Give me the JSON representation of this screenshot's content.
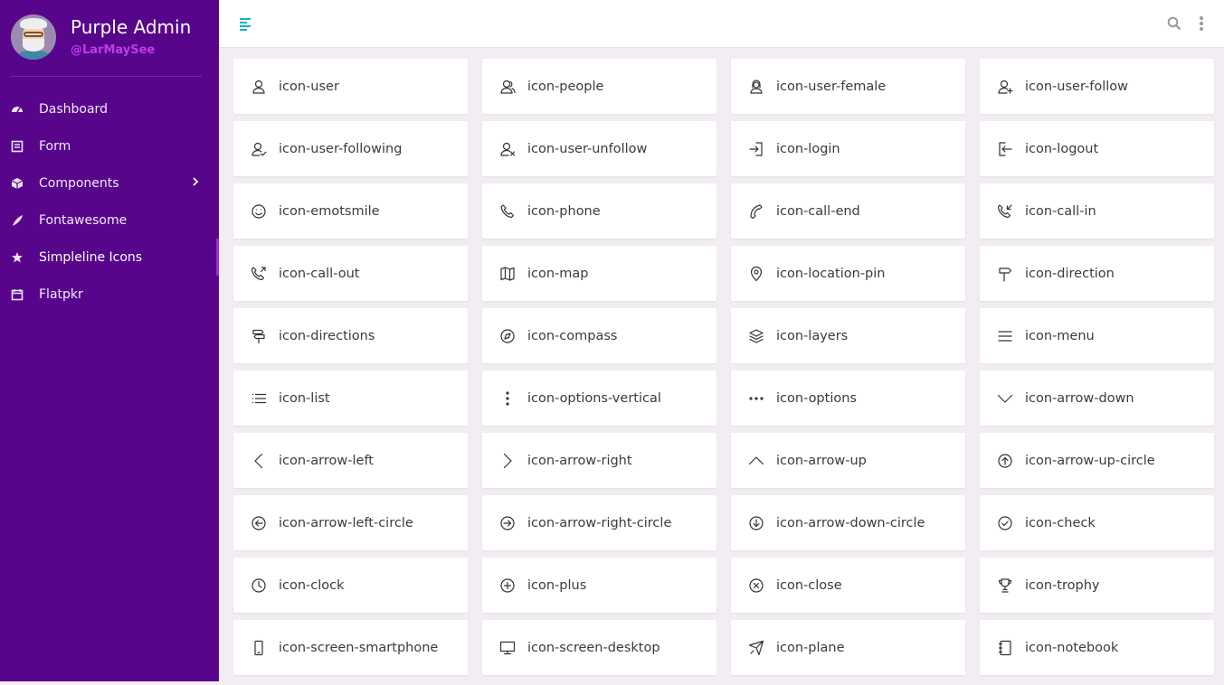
{
  "profile": {
    "name": "Purple Admin",
    "handle": "@LarMaySee"
  },
  "sidebar": {
    "items": [
      {
        "label": "Dashboard",
        "icon": "speedometer-icon",
        "active": false
      },
      {
        "label": "Form",
        "icon": "form-icon",
        "active": false
      },
      {
        "label": "Components",
        "icon": "cube-icon",
        "active": false,
        "has_submenu": true
      },
      {
        "label": "Fontawesome",
        "icon": "feather-icon",
        "active": false
      },
      {
        "label": "Simpleline Icons",
        "icon": "star-icon",
        "active": true
      },
      {
        "label": "Flatpkr",
        "icon": "calendar-icon",
        "active": false
      }
    ]
  },
  "topbar": {
    "menu_icon": "menu-toggle-icon",
    "search_icon": "search-icon",
    "options_icon": "options-vertical-icon"
  },
  "colors": {
    "sidebar": "#57068c",
    "accent": "#c03ae8",
    "toggle": "#11b3c6",
    "background": "#f2edf3"
  },
  "icons": [
    "icon-user",
    "icon-people",
    "icon-user-female",
    "icon-user-follow",
    "icon-user-following",
    "icon-user-unfollow",
    "icon-login",
    "icon-logout",
    "icon-emotsmile",
    "icon-phone",
    "icon-call-end",
    "icon-call-in",
    "icon-call-out",
    "icon-map",
    "icon-location-pin",
    "icon-direction",
    "icon-directions",
    "icon-compass",
    "icon-layers",
    "icon-menu",
    "icon-list",
    "icon-options-vertical",
    "icon-options",
    "icon-arrow-down",
    "icon-arrow-left",
    "icon-arrow-right",
    "icon-arrow-up",
    "icon-arrow-up-circle",
    "icon-arrow-left-circle",
    "icon-arrow-right-circle",
    "icon-arrow-down-circle",
    "icon-check",
    "icon-clock",
    "icon-plus",
    "icon-close",
    "icon-trophy",
    "icon-screen-smartphone",
    "icon-screen-desktop",
    "icon-plane",
    "icon-notebook"
  ]
}
